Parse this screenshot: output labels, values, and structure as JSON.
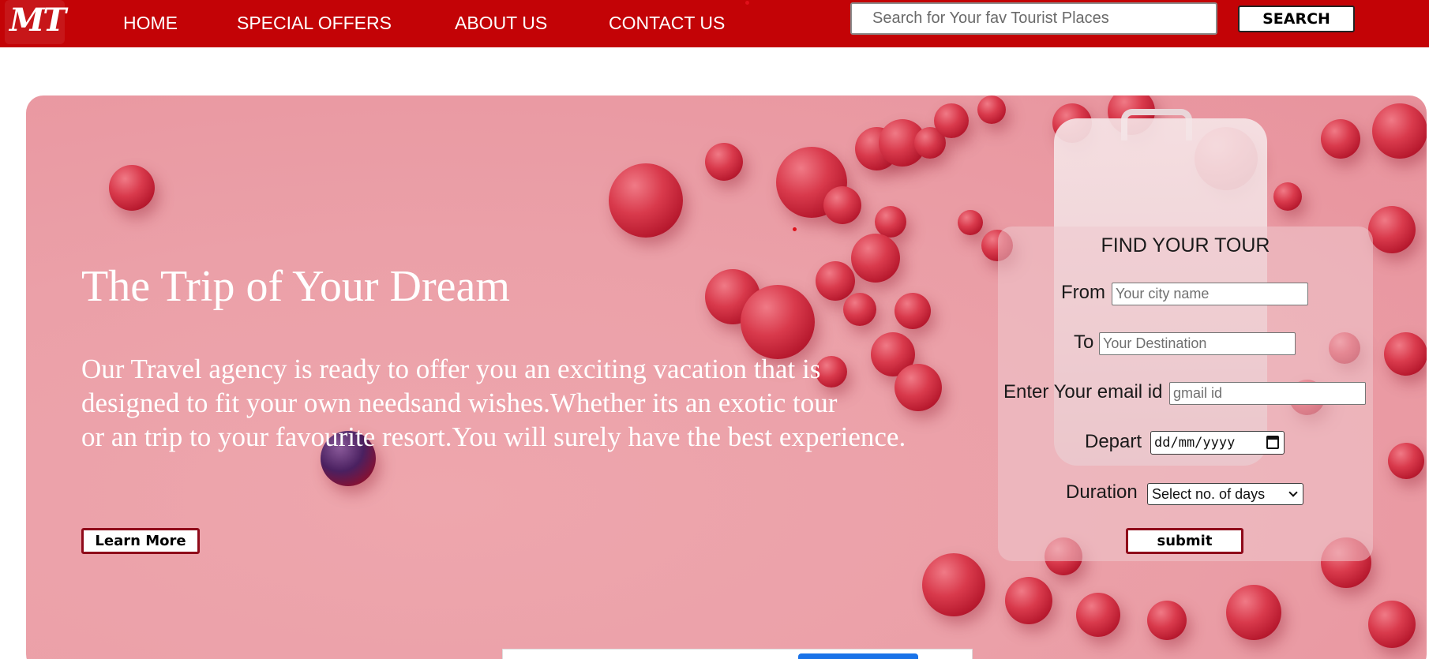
{
  "brand": {
    "logo_text": "MT"
  },
  "nav": {
    "items": [
      {
        "label": "HOME"
      },
      {
        "label": "SPECIAL OFFERS"
      },
      {
        "label": "ABOUT US"
      },
      {
        "label": "CONTACT US"
      }
    ]
  },
  "search": {
    "placeholder": "Search for Your fav Tourist Places",
    "button_label": "SEARCH"
  },
  "hero": {
    "title": "The Trip of Your Dream",
    "lines": [
      "Our Travel agency is ready to offer you an exciting vacation that is",
      "designed to fit your own needsand wishes.Whether its an exotic tour",
      "or an trip to your favourite resort.You will surely have the best experience."
    ],
    "cta_label": "Learn More"
  },
  "tour_form": {
    "title": "FIND YOUR TOUR",
    "from_label": "From",
    "from_placeholder": "Your city name",
    "to_label": "To",
    "to_placeholder": "Your Destination",
    "email_label": "Enter Your email id",
    "email_placeholder": "gmail id",
    "depart_label": "Depart",
    "depart_value": "dd/mm/yyyy",
    "duration_label": "Duration",
    "duration_value": "Select no. of days",
    "submit_label": "submit"
  },
  "colors": {
    "navbar": "#c30306",
    "hero_bg": "#eba0a8",
    "button_border": "#8f0a1a"
  }
}
